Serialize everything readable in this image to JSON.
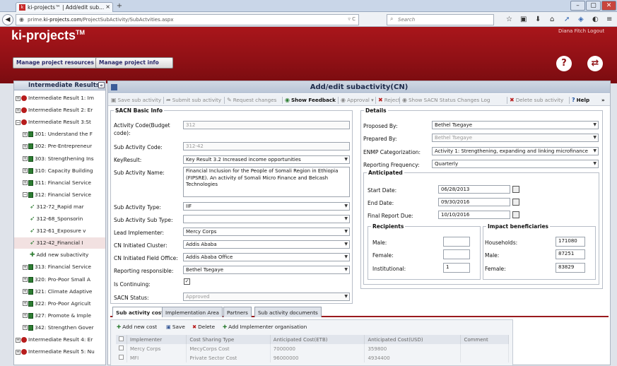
{
  "browser": {
    "tab_title": "ki-projects™ | Add/edit sub...",
    "tab_close": "×",
    "new_tab": "+",
    "url_prefix": "prime.",
    "url_host": "ki-projects.com",
    "url_path": "/ProjectSubActivity/SubActvities.aspx",
    "search_placeholder": "Search",
    "window_buttons": [
      "–",
      "▢",
      "✕"
    ]
  },
  "app": {
    "logo": "ki-projects",
    "logo_tm": "TM",
    "user_links": "Diana Fitch  Logout",
    "buttons": {
      "manage_resources": "Manage project resources",
      "manage_info": "Manage project info"
    },
    "help_glyph": "?",
    "switch_glyph": "⇄"
  },
  "tree": {
    "header": "Intermediate Results",
    "collapse": "«",
    "items": [
      {
        "label": "Intermediate Result 1: Im",
        "type": "ir",
        "exp": "+"
      },
      {
        "label": "Intermediate Result 2: Er",
        "type": "ir",
        "exp": "+"
      },
      {
        "label": "Intermediate Result 3:St",
        "type": "ir",
        "exp": "−"
      },
      {
        "label": "301: Understand the F",
        "type": "doc",
        "exp": "+"
      },
      {
        "label": "302: Pre-Entrepreneur",
        "type": "doc",
        "exp": "+"
      },
      {
        "label": "303: Strengthening Ins",
        "type": "doc",
        "exp": "+"
      },
      {
        "label": "310: Capacity Building",
        "type": "doc",
        "exp": "+"
      },
      {
        "label": "311: Financial Service",
        "type": "doc",
        "exp": "+"
      },
      {
        "label": "312: Financial Service",
        "type": "doc",
        "exp": "−"
      },
      {
        "label": "312-72_Rapid mar",
        "type": "leaf"
      },
      {
        "label": "312-68_Sponsorin",
        "type": "leaf"
      },
      {
        "label": "312-61_Exposure v",
        "type": "leaf"
      },
      {
        "label": "312-42_Financial I",
        "type": "leaf",
        "selected": true
      },
      {
        "label": "Add new subactivity",
        "type": "add"
      },
      {
        "label": "313: Financial Service",
        "type": "doc",
        "exp": "+"
      },
      {
        "label": "320: Pro-Poor Small A",
        "type": "doc",
        "exp": "+"
      },
      {
        "label": "321: Climate Adaptive",
        "type": "doc",
        "exp": "+"
      },
      {
        "label": "322: Pro-Poor Agricult",
        "type": "doc",
        "exp": "+"
      },
      {
        "label": "327: Promote & Imple",
        "type": "doc",
        "exp": "+"
      },
      {
        "label": "342: Strengthen Gover",
        "type": "doc",
        "exp": "+"
      },
      {
        "label": "Intermediate Result 4: Er",
        "type": "ir",
        "exp": "+"
      },
      {
        "label": "Intermediate Result 5: Nu",
        "type": "ir",
        "exp": "+"
      }
    ]
  },
  "page_title": "Add/edit subactivity(CN)",
  "toolbar": {
    "save": "Save sub activity",
    "submit": "Submit sub activity",
    "request": "Request changes",
    "feedback": "Show Feedback",
    "approval": "Approval",
    "reject": "Reject",
    "status_log": "Show SACN Status Changes Log",
    "delete": "Delete sub activity",
    "help": "Help",
    "more": "»"
  },
  "basic": {
    "legend": "SACN Basic Info",
    "activity_code_label": "Activity Code(Budget code):",
    "activity_code": "312",
    "sub_code_label": "Sub Activity Code:",
    "sub_code": "312-42",
    "key_result_label": "KeyResult:",
    "key_result": "Key Result 3.2 Increased income opportunities",
    "name_label": "Sub Activity Name:",
    "name": "Financial Inclusion for the People of Somali Region in Ethiopia (FIPSRE). An activity of Somali Micro Finance and Belcash Technologies",
    "type_label": "Sub Activity Type:",
    "type": "IIF",
    "subtype_label": "Sub Activity Sub Type:",
    "subtype": "",
    "lead_label": "Lead Implementer:",
    "lead": "Mercy Corps",
    "cluster_label": "CN Initiated Cluster:",
    "cluster": "Addis Ababa",
    "field_office_label": "CN Initiated Field Office:",
    "field_office": "Addis Ababa Office",
    "reporting_label": "Reporting responsible:",
    "reporting": "Bethel Tsegaye",
    "continuing_label": "Is Continuing:",
    "continuing_mark": "✓",
    "status_label": "SACN Status:",
    "status": "Approved"
  },
  "details": {
    "legend": "Details",
    "proposed_label": "Proposed By:",
    "proposed": "Bethel Tsegaye",
    "prepared_label": "Prepared By:",
    "prepared": "Bethel Tsegaye",
    "enmp_label": "ENMP Categorization:",
    "enmp": "Activity 1:  Strengthening, expanding and linking microfinance",
    "freq_label": "Reporting Frequency:",
    "freq": "Quarterly",
    "anticipated_legend": "Anticipated",
    "start_label": "Start Date:",
    "start": "06/28/2013",
    "end_label": "End Date:",
    "end": "09/30/2016",
    "final_label": "Final Report Due:",
    "final": "10/10/2016",
    "recipients_legend": "Recipients",
    "male_label": "Male:",
    "male": "",
    "female_label": "Female:",
    "female": "",
    "institutional_label": "Institutional:",
    "institutional": "1",
    "impact_legend": "Impact beneficiaries",
    "households_label": "Households:",
    "households": "171080",
    "imale_label": "Male:",
    "imale": "87251",
    "ifemale_label": "Female:",
    "ifemale": "83829"
  },
  "tabs": [
    "Sub activity cost",
    "Implementation Area",
    "Partners",
    "Sub activity documents"
  ],
  "grid": {
    "add_cost": "Add new cost",
    "save": "Save",
    "delete": "Delete",
    "add_org": "Add Implementer organisation",
    "columns": [
      "Implementer",
      "Cost Sharing Type",
      "Anticipated Cost(ETB)",
      "Anticipated Cost(USD)",
      "Comment"
    ],
    "rows": [
      [
        "Mercy Corps",
        "MecyCorps Cost",
        "7000000",
        "359800",
        ""
      ],
      [
        "MFI",
        "Private Sector Cost",
        "96000000",
        "4934400",
        ""
      ]
    ]
  }
}
